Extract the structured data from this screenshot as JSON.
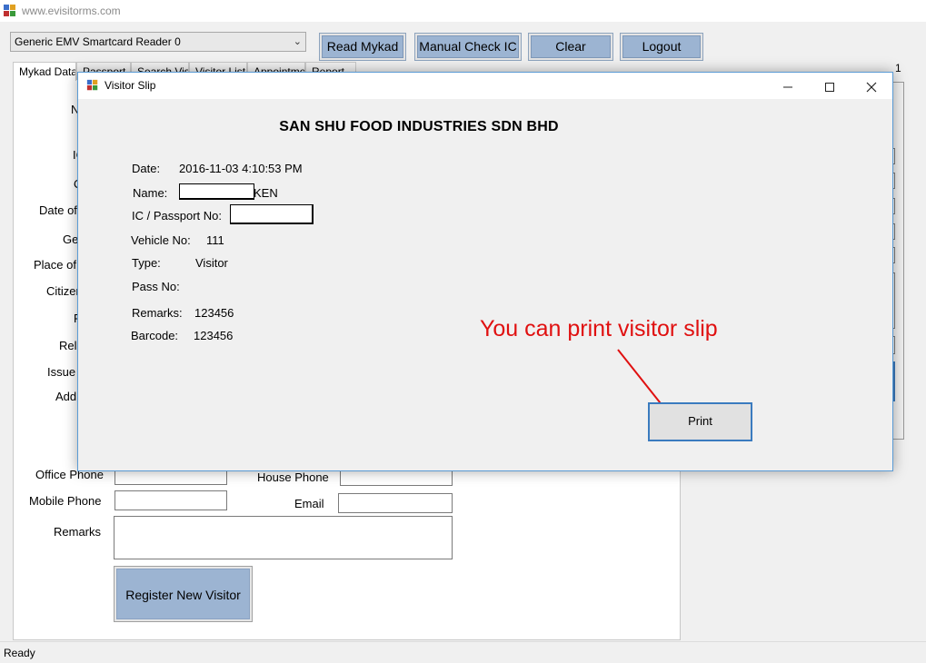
{
  "window": {
    "title": "www.evisitorms.com"
  },
  "toolbar": {
    "reader_select": "Generic EMV Smartcard Reader 0",
    "read_mykad": "Read Mykad",
    "manual_check_ic": "Manual Check IC",
    "clear": "Clear",
    "logout": "Logout"
  },
  "tabs": [
    "Mykad Data",
    "Passport",
    "Search Visitor",
    "Visitor List",
    "Appointment",
    "Report"
  ],
  "form": {
    "labels_partial": [
      "N",
      "IC",
      "O",
      "Date of",
      "Ge",
      "Place of",
      "Citizen",
      "R",
      "Rel",
      "Issue",
      "Add"
    ],
    "office_phone": "Office Phone",
    "house_phone": "House Phone",
    "mobile_phone": "Mobile Phone",
    "email": "Email",
    "remarks": "Remarks",
    "register_button": "Register New Visitor"
  },
  "right_panel": {
    "number": "1"
  },
  "status": {
    "text": "Ready"
  },
  "dialog": {
    "title": "Visitor Slip",
    "company": "SAN SHU FOOD INDUSTRIES SDN BHD",
    "date_label": "Date:",
    "date_value": "2016-11-03 4:10:53 PM",
    "name_label": "Name:",
    "name_value": "KEN",
    "ic_label": "IC / Passport No:",
    "vehicle_label": "Vehicle No:",
    "vehicle_value": "111",
    "type_label": "Type:",
    "type_value": "Visitor",
    "pass_label": "Pass No:",
    "pass_value": "",
    "remarks_label": "Remarks:",
    "remarks_value": "123456",
    "barcode_label": "Barcode:",
    "barcode_value": "123456",
    "print_button": "Print",
    "annotation": "You can print visitor slip"
  },
  "colors": {
    "button_face": "#9cb4d2",
    "annotation_red": "#e01010",
    "dialog_border": "#5a9bd5"
  }
}
